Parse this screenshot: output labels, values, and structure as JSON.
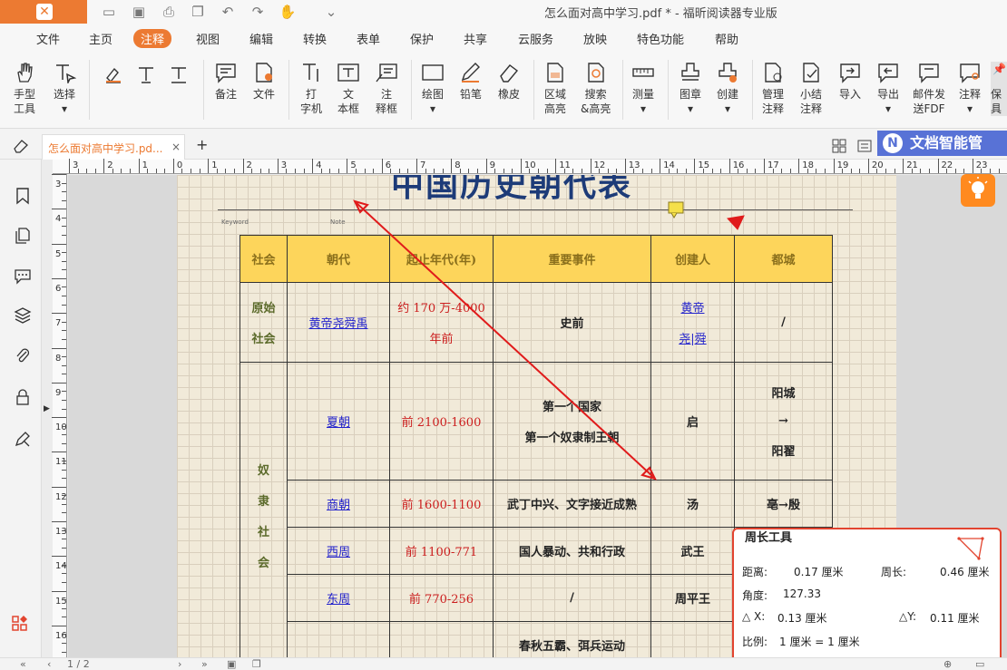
{
  "window": {
    "title": "怎么面对高中学习.pdf * - 福昕阅读器专业版"
  },
  "menu": [
    "文件",
    "主页",
    "注释",
    "视图",
    "编辑",
    "转换",
    "表单",
    "保护",
    "共享",
    "云服务",
    "放映",
    "特色功能",
    "帮助"
  ],
  "menu_active": "注释",
  "ribbon": {
    "hand": "手型\n工具",
    "select": "选择",
    "note": "备注",
    "file": "文件",
    "typewriter": "打\n字机",
    "textbox": "文\n本框",
    "callout": "注\n释框",
    "drawing": "绘图",
    "pencil": "铅笔",
    "eraser": "橡皮",
    "area_highlight": "区域\n高亮",
    "search_highlight": "搜索\n&高亮",
    "measure": "测量",
    "stamp": "图章",
    "create": "创建",
    "manage": "管理\n注释",
    "summary": "小结\n注释",
    "import": "导入",
    "export": "导出",
    "email": "邮件发\n送FDF",
    "comment": "注释",
    "keep": "保\n具"
  },
  "tab": {
    "name": "怎么面对高中学习.pd...",
    "close": "×",
    "new": "+"
  },
  "ai_button": "文档智能管",
  "ruler_top": [
    "3",
    "2",
    "1",
    "0",
    "1",
    "2",
    "3",
    "4",
    "5",
    "6",
    "7",
    "8",
    "9",
    "10",
    "11",
    "12",
    "13",
    "14",
    "15",
    "16",
    "17",
    "18",
    "19",
    "20",
    "21",
    "22",
    "23"
  ],
  "ruler_left": [
    "3",
    "4",
    "5",
    "6",
    "7",
    "8",
    "9",
    "10",
    "11",
    "12",
    "13",
    "14",
    "15",
    "16"
  ],
  "page": {
    "title": "中国历史朝代表",
    "keyword_label": "Keyword",
    "note_label": "Note"
  },
  "table": {
    "headers": [
      "社会",
      "朝代",
      "起止年代(年)",
      "重要事件",
      "创建人",
      "都城"
    ],
    "primitive_society": "原始\n\n社会",
    "slave_society": "奴\n\n隶\n\n社\n\n会",
    "rows": [
      {
        "dynasty": "黄帝尧舜禹",
        "years": "约 170 万-4000\n\n年前",
        "event": "史前",
        "founder": "黄帝\n\n尧|舜",
        "capital": "/"
      },
      {
        "dynasty": "夏朝",
        "years": "前 2100-1600",
        "event": "第一个国家\n\n第一个奴隶制王朝",
        "founder": "启",
        "capital": "阳城\n\n→\n\n阳翟"
      },
      {
        "dynasty": "商朝",
        "years": "前 1600-1100",
        "event": "武丁中兴、文字接近成熟",
        "founder": "汤",
        "capital": "亳→殷"
      },
      {
        "dynasty": "西周",
        "years": "前 1100-771",
        "event": "国人暴动、共和行政",
        "founder": "武王",
        "capital": ""
      },
      {
        "dynasty": "东周",
        "years": "前 770-256",
        "event": "/",
        "founder": "周平王",
        "capital": ""
      },
      {
        "dynasty": "",
        "years": "",
        "event": "春秋五霸、弭兵运动",
        "founder": "",
        "capital": ""
      }
    ]
  },
  "measure_panel": {
    "title": "周长工具",
    "distance_label": "距离:",
    "distance_value": "0.17 厘米",
    "perimeter_label": "周长:",
    "perimeter_value": "0.46 厘米",
    "angle_label": "角度:",
    "angle_value": "127.33",
    "dx_label": "△ X:",
    "dx_value": "0.13 厘米",
    "dy_label": "△Y:",
    "dy_value": "0.11 厘米",
    "scale_label": "比例:",
    "scale_value": "1 厘米 = 1 厘米"
  },
  "statusbar": {
    "page": "1 / 2"
  },
  "colors": {
    "accent": "#ec7a32",
    "ai_blue": "#5872d6",
    "header_yellow": "#fdd55b",
    "measure_red": "#e2442f",
    "arrow_red": "#e01b1b"
  }
}
